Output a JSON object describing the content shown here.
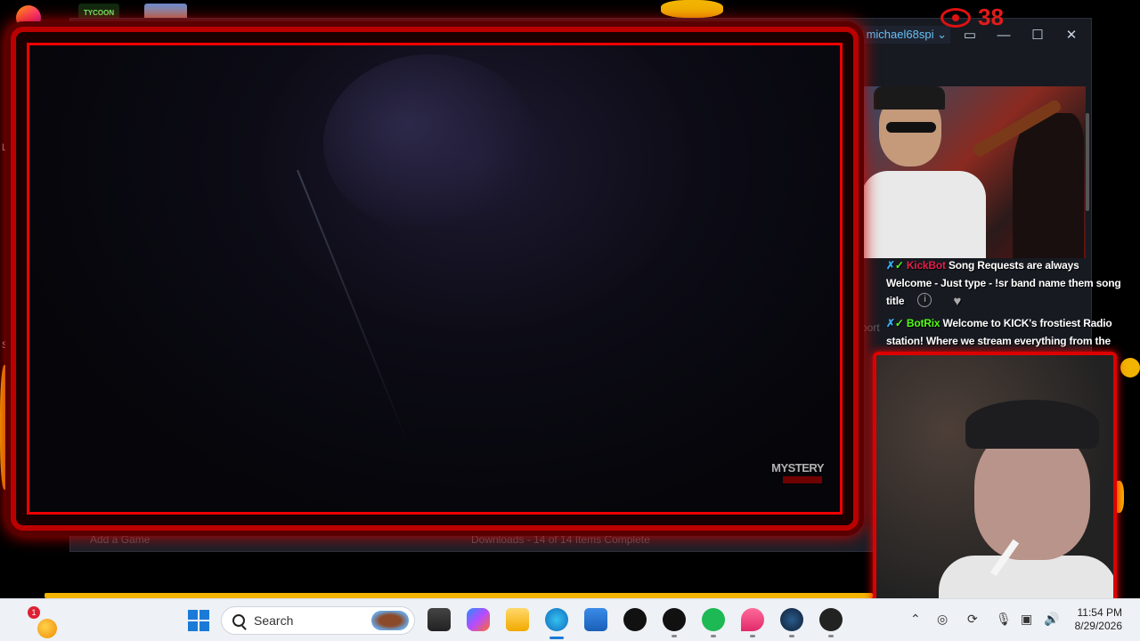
{
  "desktop": {
    "tycoon_label": "TYCOON",
    "side_texts": [
      "Lu",
      "Se"
    ]
  },
  "steam": {
    "help": "?",
    "username": "michael68spi",
    "user_chevron": "⌄",
    "minimize": "—",
    "maximize": "☐",
    "close": "✕",
    "add_game": "Add a Game",
    "downloads": "Downloads - 14 of 14 Items Complete",
    "support": "port"
  },
  "overlay": {
    "viewer_count": "38",
    "watermark": "MYSTERY"
  },
  "chat": {
    "messages": [
      {
        "badges": "✗",
        "badge2": "✓",
        "user": "KickBot",
        "text": "Song Requests are always Welcome - Just type - !sr band name them song title"
      },
      {
        "badges": "✗",
        "badge2": "✓",
        "user": "BotRix",
        "text": "Welcome to KICK's frostiest Radio station! Where we stream everything from the hottest classic rock to the heaviest of metal to fuel your love for them frosty tunes!"
      }
    ],
    "info_glyph": "i",
    "heart_glyph": "♥"
  },
  "taskbar": {
    "notification_count": "1",
    "search_placeholder": "Search",
    "tray_chevron": "⌃",
    "time": "11:54 PM",
    "date": "8/29/2026"
  },
  "colors": {
    "accent_red": "#e00000",
    "kick_green": "#53fc18",
    "steam_blue": "#67c1f5",
    "windows_blue": "#1a7ad8"
  }
}
